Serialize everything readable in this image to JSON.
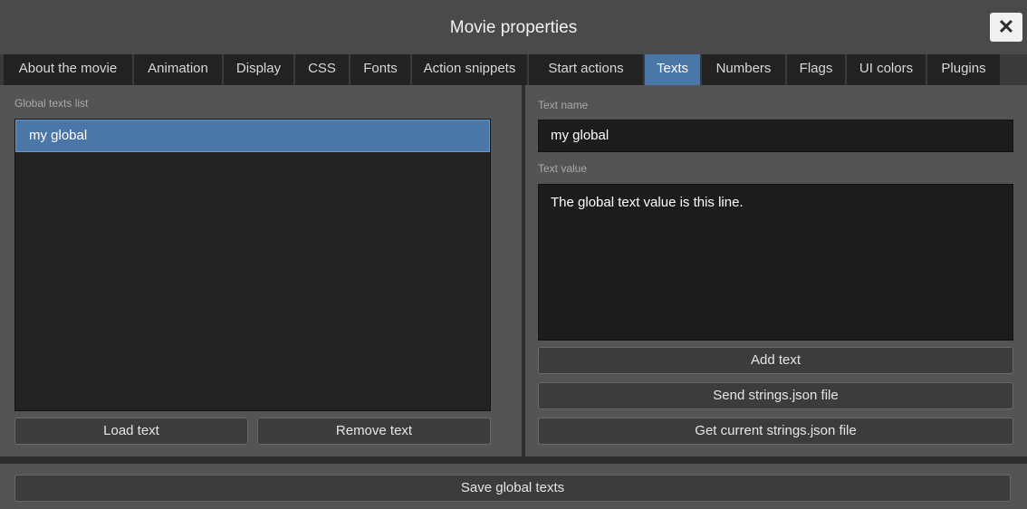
{
  "window": {
    "title": "Movie properties",
    "close_label": "✕"
  },
  "tabs": [
    {
      "label": "About the movie",
      "active": false
    },
    {
      "label": "Animation",
      "active": false
    },
    {
      "label": "Display",
      "active": false
    },
    {
      "label": "CSS",
      "active": false
    },
    {
      "label": "Fonts",
      "active": false
    },
    {
      "label": "Action snippets",
      "active": false
    },
    {
      "label": "Start actions",
      "active": false
    },
    {
      "label": "Texts",
      "active": true
    },
    {
      "label": "Numbers",
      "active": false
    },
    {
      "label": "Flags",
      "active": false
    },
    {
      "label": "UI colors",
      "active": false
    },
    {
      "label": "Plugins",
      "active": false
    }
  ],
  "left": {
    "list_label": "Global texts list",
    "items": [
      "my global"
    ],
    "load_button": "Load text",
    "remove_button": "Remove text"
  },
  "right": {
    "name_label": "Text name",
    "name_value": "my global",
    "value_label": "Text value",
    "value_text": "The global text value is this line.",
    "add_button": "Add text",
    "send_button": "Send strings.json file",
    "get_button": "Get current strings.json file"
  },
  "footer": {
    "save_button": "Save global texts"
  },
  "colors": {
    "accent": "#4a77a7",
    "background": "#545454",
    "field": "#1c1c1c"
  }
}
